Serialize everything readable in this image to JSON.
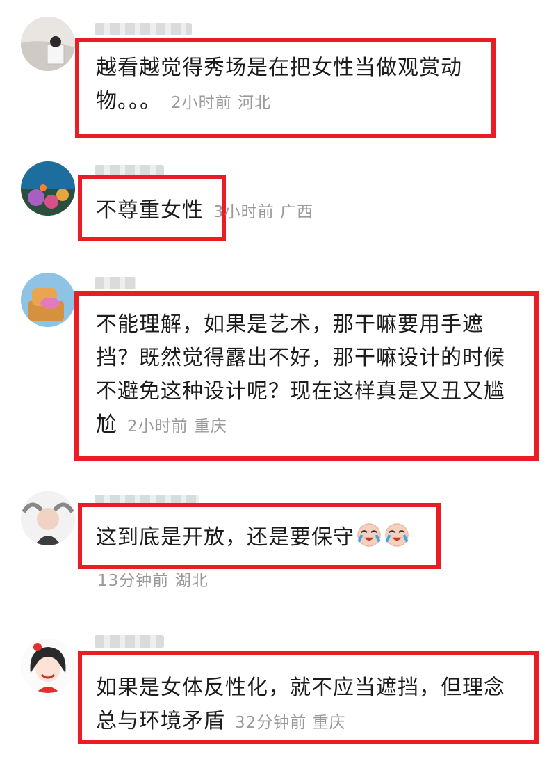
{
  "comments": [
    {
      "text": "越看越觉得秀场是在把女性当做观赏动物。。。",
      "time": "2小时前",
      "location": "河北"
    },
    {
      "text": "不尊重女性",
      "time": "3小时前",
      "location": "广西"
    },
    {
      "text": "不能理解，如果是艺术，那干嘛要用手遮挡？既然觉得露出不好，那干嘛设计的时候不避免这种设计呢？现在这样真是又丑又尴尬",
      "time": "2小时前",
      "location": "重庆"
    },
    {
      "text": "这到底是开放，还是要保守",
      "emoji": "crying-laughing-face",
      "time": "13分钟前",
      "location": "湖北"
    },
    {
      "text": "如果是女体反性化，就不应当遮挡，但理念总与环境矛盾",
      "time": "32分钟前",
      "location": "重庆"
    }
  ],
  "colors": {
    "highlight": "#ea1c24",
    "meta": "#9a9a9a",
    "text": "#1c1c1c"
  }
}
